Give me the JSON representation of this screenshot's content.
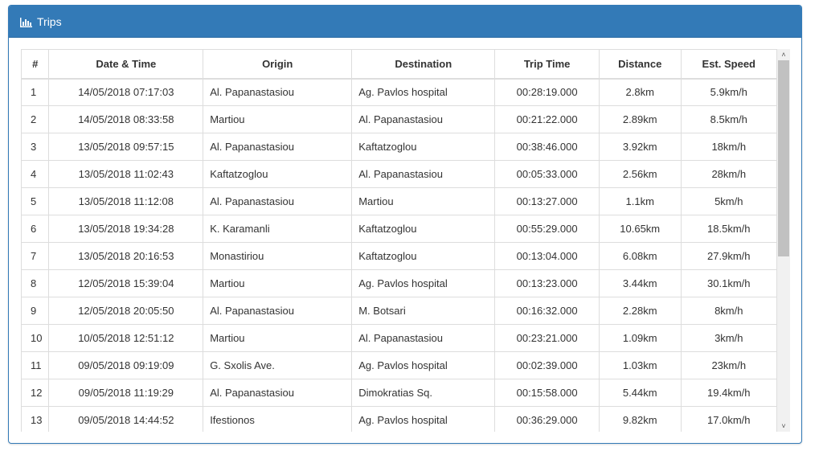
{
  "panel": {
    "title": "Trips",
    "icon": "bar-chart-icon"
  },
  "table": {
    "headers": [
      "#",
      "Date & Time",
      "Origin",
      "Destination",
      "Trip Time",
      "Distance",
      "Est. Speed"
    ],
    "rows": [
      [
        "1",
        "14/05/2018 07:17:03",
        "Al. Papanastasiou",
        "Ag. Pavlos hospital",
        "00:28:19.000",
        "2.8km",
        "5.9km/h"
      ],
      [
        "2",
        "14/05/2018 08:33:58",
        "Martiou",
        "Al. Papanastasiou",
        "00:21:22.000",
        "2.89km",
        "8.5km/h"
      ],
      [
        "3",
        "13/05/2018 09:57:15",
        "Al. Papanastasiou",
        "Kaftatzoglou",
        "00:38:46.000",
        "3.92km",
        "18km/h"
      ],
      [
        "4",
        "13/05/2018 11:02:43",
        "Kaftatzoglou",
        "Al. Papanastasiou",
        "00:05:33.000",
        "2.56km",
        "28km/h"
      ],
      [
        "5",
        "13/05/2018 11:12:08",
        "Al. Papanastasiou",
        "Martiou",
        "00:13:27.000",
        "1.1km",
        "5km/h"
      ],
      [
        "6",
        "13/05/2018 19:34:28",
        "K. Karamanli",
        "Kaftatzoglou",
        "00:55:29.000",
        "10.65km",
        "18.5km/h"
      ],
      [
        "7",
        "13/05/2018 20:16:53",
        "Monastiriou",
        "Kaftatzoglou",
        "00:13:04.000",
        "6.08km",
        "27.9km/h"
      ],
      [
        "8",
        "12/05/2018 15:39:04",
        "Martiou",
        "Ag. Pavlos hospital",
        "00:13:23.000",
        "3.44km",
        "30.1km/h"
      ],
      [
        "9",
        "12/05/2018 20:05:50",
        "Al. Papanastasiou",
        "M. Botsari",
        "00:16:32.000",
        "2.28km",
        "8km/h"
      ],
      [
        "10",
        "10/05/2018 12:51:12",
        "Martiou",
        "Al. Papanastasiou",
        "00:23:21.000",
        "1.09km",
        "3km/h"
      ],
      [
        "11",
        "09/05/2018 09:19:09",
        "G. Sxolis Ave.",
        "Ag. Pavlos hospital",
        "00:02:39.000",
        "1.03km",
        "23km/h"
      ],
      [
        "12",
        "09/05/2018 11:19:29",
        "Al. Papanastasiou",
        "Dimokratias Sq.",
        "00:15:58.000",
        "5.44km",
        "19.4km/h"
      ],
      [
        "13",
        "09/05/2018 14:44:52",
        "Ifestionos",
        "Ag. Pavlos hospital",
        "00:36:29.000",
        "9.82km",
        "17.0km/h"
      ]
    ]
  },
  "scrollbar": {
    "up_icon": "chevron-up-icon",
    "down_icon": "chevron-down-icon",
    "up_glyph": "˄",
    "down_glyph": "˅"
  },
  "colors": {
    "header_bg": "#337ab7",
    "header_text": "#ffffff",
    "border": "#dddddd"
  }
}
